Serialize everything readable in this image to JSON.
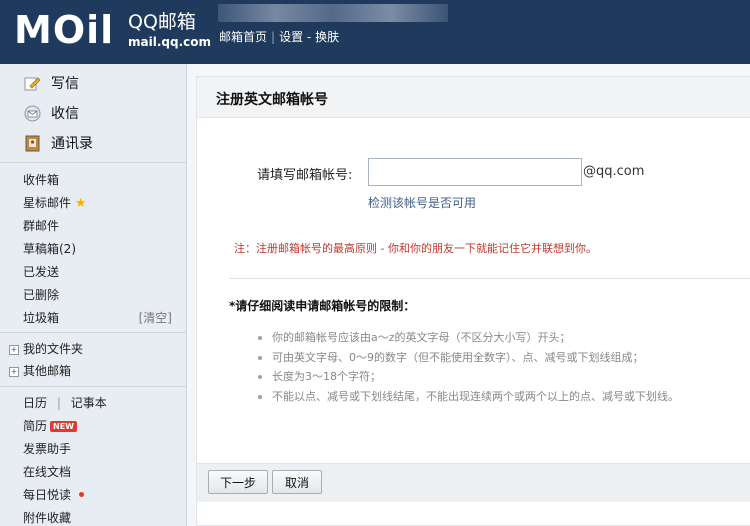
{
  "header": {
    "logo_text": "MOil",
    "brand": "QQ邮箱",
    "domain": "mail.qq.com",
    "nav": {
      "home": "邮箱首页",
      "settings": "设置",
      "dash": "-",
      "skin": "换肤"
    }
  },
  "sidebar": {
    "actions": {
      "compose": "写信",
      "inbox": "收信",
      "contacts": "通讯录"
    },
    "folders": {
      "inbox": "收件箱",
      "starred": "星标邮件",
      "group": "群邮件",
      "drafts": "草稿箱(2)",
      "sent": "已发送",
      "deleted": "已删除",
      "spam": "垃圾箱",
      "spam_clear": "[清空]"
    },
    "my_folders": "我的文件夹",
    "other_mailboxes": "其他邮箱",
    "apps": {
      "calendar": "日历",
      "notes": "记事本",
      "resume": "简历",
      "new_badge": "NEW",
      "invoice": "发票助手",
      "docs": "在线文档",
      "daily": "每日悦读",
      "attachments": "附件收藏"
    }
  },
  "form": {
    "title": "注册英文邮箱帐号",
    "email_label": "请填写邮箱帐号:",
    "email_value": "",
    "email_suffix": "@qq.com",
    "check_link": "检测该帐号是否可用",
    "notice": "注：注册邮箱帐号的最高原则 - 你和你的朋友一下就能记住它并联想到你。",
    "restrict_title": "*请仔细阅读申请邮箱帐号的限制：",
    "rules": [
      "你的邮箱帐号应该由a～z的英文字母（不区分大小写）开头；",
      "可由英文字母、0～9的数字（但不能使用全数字）、点、减号或下划线组成；",
      "长度为3～18个字符；",
      "不能以点、减号或下划线结尾，不能出现连续两个或两个以上的点、减号或下划线。"
    ]
  },
  "buttons": {
    "next": "下一步",
    "cancel": "取消"
  },
  "colors": {
    "header_bg": "#1f3a5c",
    "sidebar_bg": "#e8edf3",
    "notice_red": "#c0392b",
    "link_blue": "#3d5f8a"
  }
}
